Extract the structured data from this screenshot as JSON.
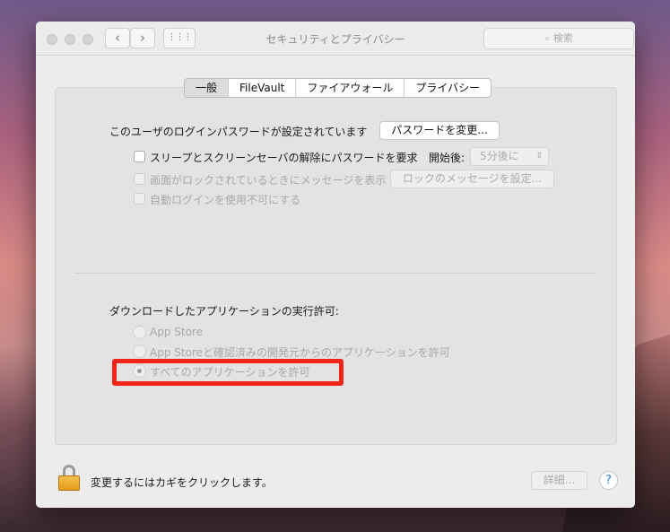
{
  "window": {
    "title": "セキュリティとプライバシー",
    "search_placeholder": "検索"
  },
  "tabs": [
    "一般",
    "FileVault",
    "ファイアウォール",
    "プライバシー"
  ],
  "general": {
    "password_label": "このユーザのログインパスワードが設定されています",
    "change_password": "パスワードを変更...",
    "require_password": "スリープとスクリーンセーバの解除にパスワードを要求",
    "start_after_label": "開始後:",
    "start_after_value": "5分後に",
    "show_message": "画面がロックされているときにメッセージを表示",
    "set_lock_message": "ロックのメッセージを設定...",
    "disable_auto_login": "自動ログインを使用不可にする",
    "download_heading": "ダウンロードしたアプリケーションの実行許可:",
    "radio_options": [
      "App Store",
      "App Storeと確認済みの開発元からのアプリケーションを許可",
      "すべてのアプリケーションを許可"
    ],
    "selected_option": "すべてのアプリケーションを許可"
  },
  "footer": {
    "lock_text": "変更するにはカギをクリックします。",
    "advanced": "詳細...",
    "help": "?"
  },
  "colors": {
    "highlight": "#f3251b"
  }
}
